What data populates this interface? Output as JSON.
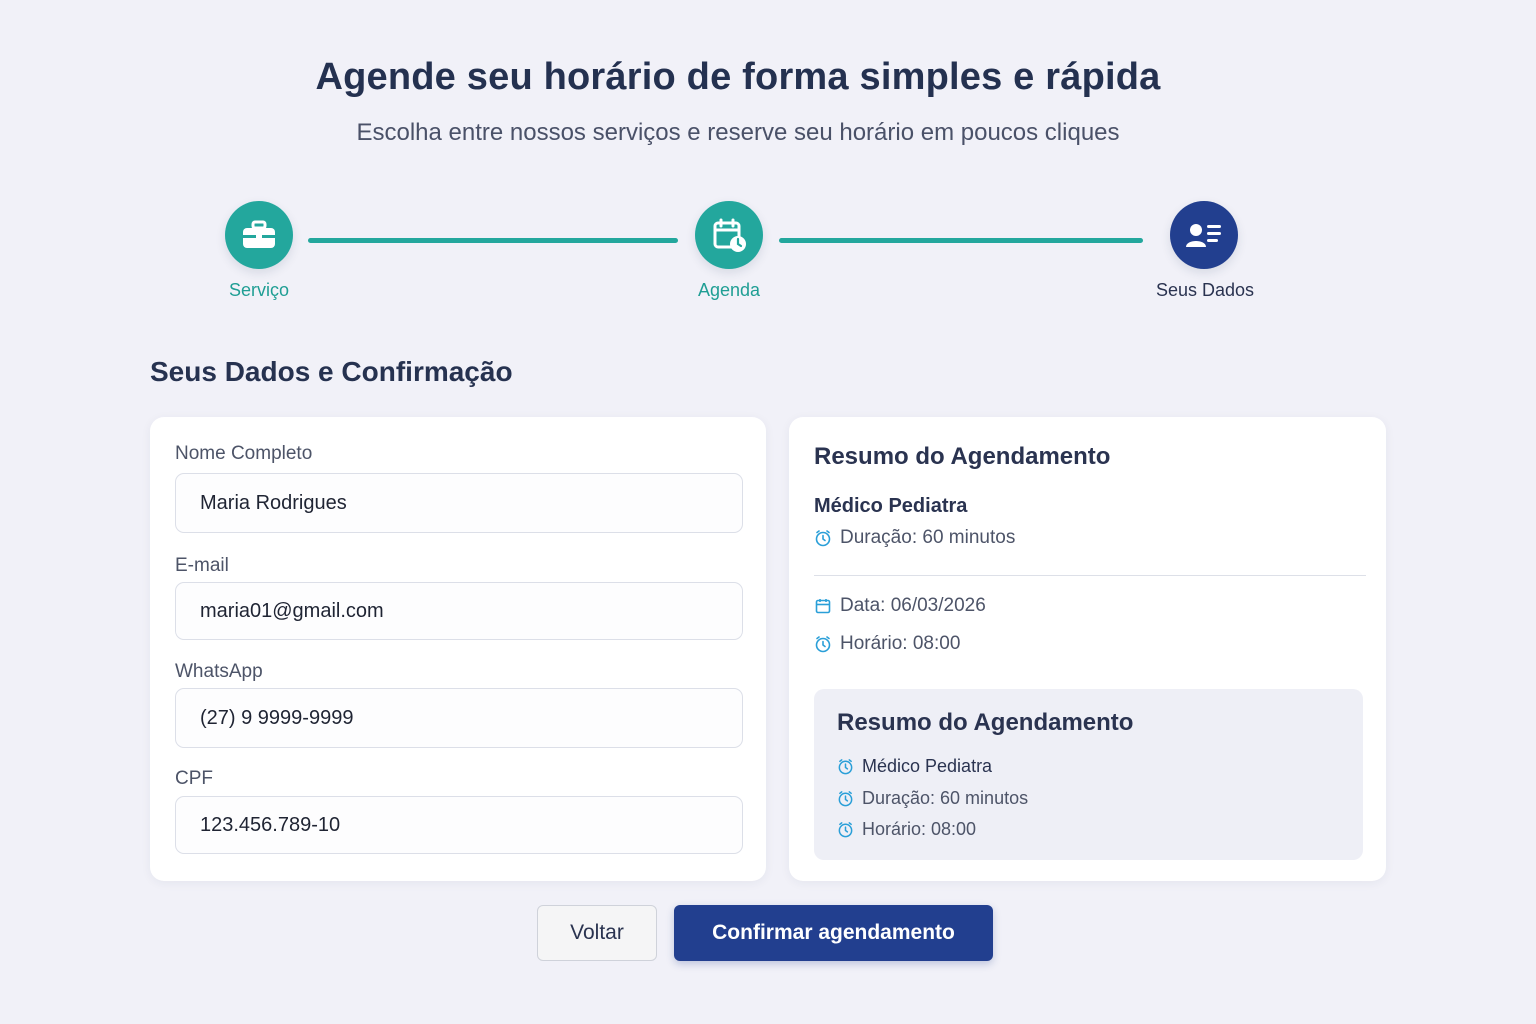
{
  "hero": {
    "title": "Agende seu horário de forma simples e rápida",
    "subtitle": "Escolha entre nossos serviços e reserve seu horário em poucos cliques"
  },
  "stepper": {
    "steps": [
      {
        "label": "Serviço",
        "icon": "briefcase-icon",
        "state": "done"
      },
      {
        "label": "Agenda",
        "icon": "calendar-clock-icon",
        "state": "done"
      },
      {
        "label": "Seus Dados",
        "icon": "user-details-icon",
        "state": "active"
      }
    ],
    "colors": {
      "done": "#23a79d",
      "active": "#223f8f"
    }
  },
  "section": {
    "title": "Seus Dados e Confirmação"
  },
  "form": {
    "name": {
      "label": "Nome Completo",
      "value": "Maria Rodrigues"
    },
    "email": {
      "label": "E-mail",
      "value": "maria01@gmail.com"
    },
    "whatsapp": {
      "label": "WhatsApp",
      "value": "(27) 9 9999-9999"
    },
    "cpf": {
      "label": "CPF",
      "value": "123.456.789-10"
    }
  },
  "summary": {
    "title": "Resumo do Agendamento",
    "service": "Médico Pediatra",
    "duration": "Duração: 60 minutos",
    "date": "Data: 06/03/2026",
    "time": "Horário: 08:00",
    "inner": {
      "title": "Resumo do Agendamento",
      "service": "Médico Pediatra",
      "duration": "Duração: 60 minutos",
      "time": "Horário: 08:00"
    }
  },
  "actions": {
    "back_label": "Voltar",
    "confirm_label": "Confirmar agendamento"
  },
  "colors": {
    "accent": "#23a79d",
    "brand": "#223f8f",
    "background": "#f1f1f8"
  }
}
